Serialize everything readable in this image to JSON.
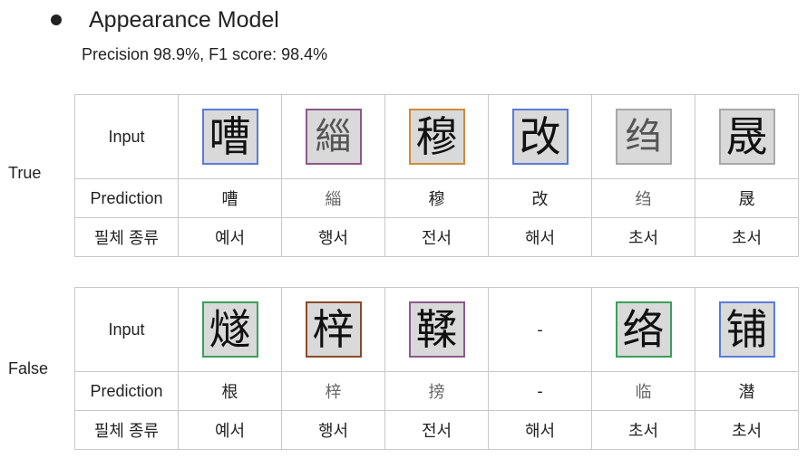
{
  "heading": "Appearance Model",
  "metrics": "Precision 98.9%, F1 score: 98.4%",
  "row_labels": {
    "input": "Input",
    "prediction": "Prediction",
    "type": "필체 종류"
  },
  "groups": [
    {
      "label": "True",
      "inputs": [
        "嘈",
        "緇",
        "穆",
        "改",
        "绉",
        "晟"
      ],
      "predictions": [
        "嘈",
        "緇",
        "穆",
        "改",
        "绉",
        "晟"
      ],
      "types": [
        "예서",
        "행서",
        "전서",
        "해서",
        "초서",
        "초서"
      ]
    },
    {
      "label": "False",
      "inputs": [
        "燧",
        "梓",
        "鞣",
        "-",
        "络",
        "铺"
      ],
      "predictions": [
        "根",
        "梓",
        "搒",
        "-",
        "临",
        "潜"
      ],
      "types": [
        "예서",
        "행서",
        "전서",
        "해서",
        "초서",
        "초서"
      ]
    }
  ],
  "colors": {
    "card_background": "#d9d9d9",
    "table_border": "#c8c8c8",
    "text": "#222222"
  },
  "icons": {
    "bullet": "bullet-dot-icon"
  }
}
